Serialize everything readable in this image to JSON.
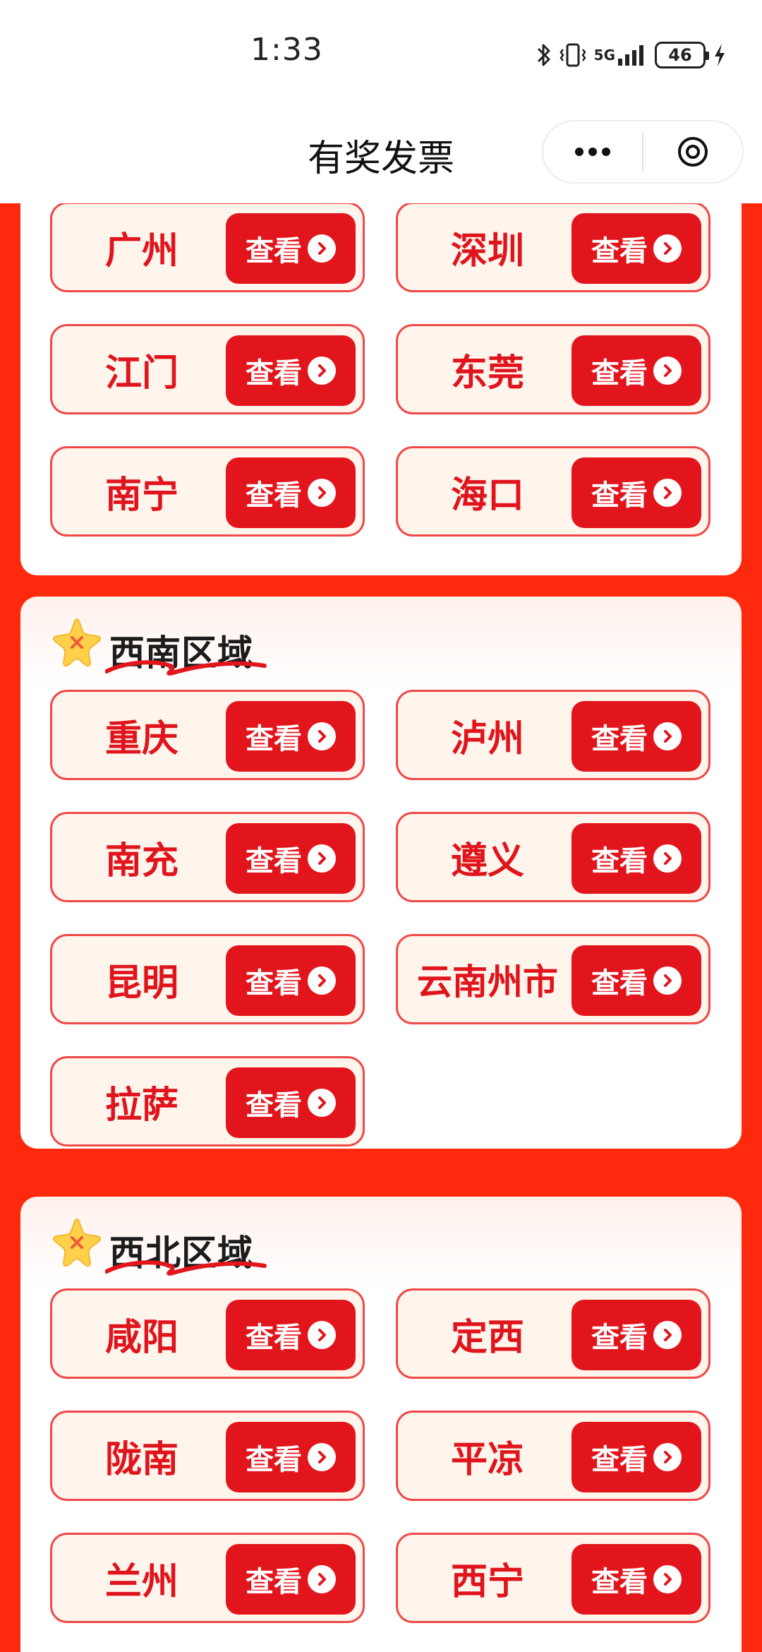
{
  "status_bar": {
    "time": "1:33",
    "network_label": "5G",
    "battery": "46",
    "icons": [
      "bluetooth-icon",
      "vibrate-icon",
      "signal-icon",
      "battery-icon",
      "charging-icon"
    ]
  },
  "header": {
    "title": "有奖发票",
    "menu_icon": "more-icon",
    "close_icon": "close-icon"
  },
  "view_label": "查看",
  "colors": {
    "background_red": "#ff2a0d",
    "button_red": "#e3151c",
    "city_text": "#e0141c",
    "card_bg": "#fff5ec",
    "card_border": "#f04848"
  },
  "sections": [
    {
      "title": "",
      "cities": [
        "广州",
        "深圳",
        "江门",
        "东莞",
        "南宁",
        "海口"
      ]
    },
    {
      "title": "西南区域",
      "cities": [
        "重庆",
        "泸州",
        "南充",
        "遵义",
        "昆明",
        "云南州市",
        "拉萨"
      ]
    },
    {
      "title": "西北区域",
      "cities": [
        "咸阳",
        "定西",
        "陇南",
        "平凉",
        "兰州",
        "西宁"
      ]
    }
  ]
}
